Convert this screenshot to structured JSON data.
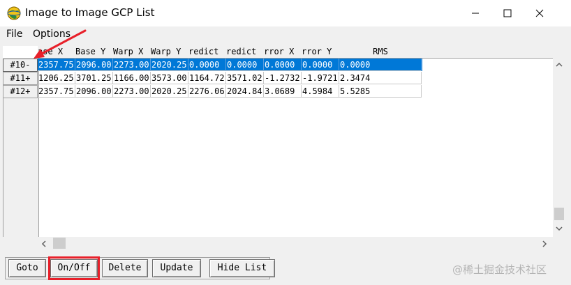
{
  "window": {
    "title": "Image to Image GCP List",
    "icon": "envi-globe-icon",
    "controls": {
      "minimize": "—",
      "maximize": "☐",
      "close": "✕"
    }
  },
  "menu": {
    "items": [
      "File",
      "Options"
    ]
  },
  "table": {
    "columns": [
      "Base X",
      "Base Y",
      "Warp X",
      "Warp Y",
      "Predict",
      "Predict",
      "Error X",
      "Error Y",
      "RMS"
    ],
    "column_header_display": [
      "ase X",
      "Base Y",
      "Warp X",
      "Warp Y",
      "redict",
      "redict",
      "rror X",
      "rror Y",
      "RMS"
    ],
    "rows": [
      {
        "header": "#10-",
        "selected": true,
        "cells": [
          "2357.75",
          "2096.00",
          "2273.00",
          "2020.25",
          "0.0000",
          "0.0000",
          "0.0000",
          "0.0000",
          "0.0000"
        ]
      },
      {
        "header": "#11+",
        "selected": false,
        "cells": [
          "1206.25",
          "3701.25",
          "1166.00",
          "3573.00",
          "1164.72",
          "3571.02",
          "-1.2732",
          "-1.9721",
          "2.3474"
        ]
      },
      {
        "header": "#12+",
        "selected": false,
        "cells": [
          "2357.75",
          "2096.00",
          "2273.00",
          "2020.25",
          "2276.06",
          "2024.84",
          "3.0689",
          "4.5984",
          "5.5285"
        ]
      }
    ]
  },
  "buttons": {
    "goto": "Goto",
    "onoff": "On/Off",
    "delete": "Delete",
    "update": "Update",
    "hide_list": "Hide List"
  },
  "watermark": "@稀土掘金技术社区",
  "colors": {
    "selection": "#0078d7",
    "annotation_red": "#e8202a"
  }
}
